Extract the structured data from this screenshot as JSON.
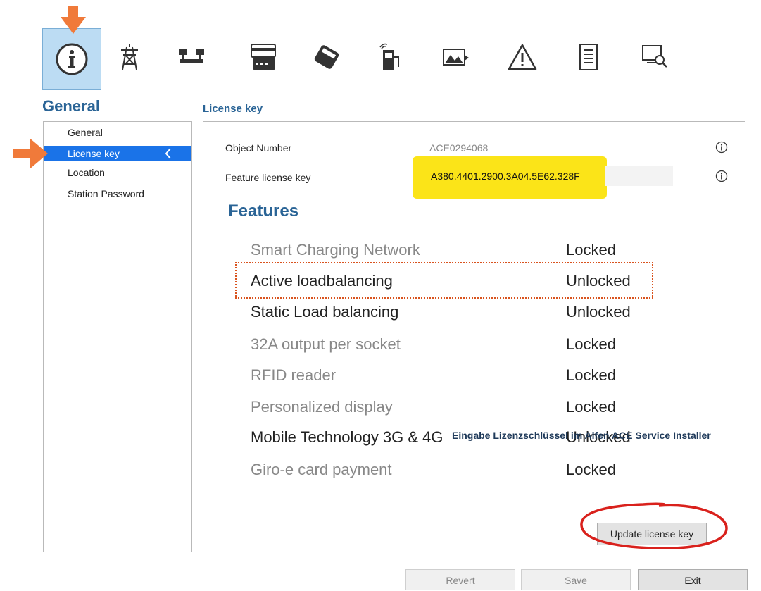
{
  "toolbar": {
    "icons": [
      "info-icon",
      "power-pylon-icon",
      "network-nodes-icon",
      "card-reader-icon",
      "payment-terminal-icon",
      "charging-station-icon",
      "display-image-icon",
      "warning-icon",
      "document-icon",
      "diagnostics-icon"
    ],
    "active_index": 0
  },
  "section": {
    "title": "General"
  },
  "nav": {
    "items": [
      {
        "label": "General"
      },
      {
        "label": "License key"
      },
      {
        "label": "Location"
      },
      {
        "label": "Station Password"
      }
    ],
    "selected_index": 1
  },
  "panel": {
    "title": "License key",
    "object_number_label": "Object Number",
    "object_number_value": "ACE0294068",
    "feature_key_label": "Feature license key",
    "feature_key_value": "A380.4401.2900.3A04.5E62.328F",
    "features_heading": "Features",
    "features": [
      {
        "name": "Smart Charging Network",
        "status": "Locked"
      },
      {
        "name": "Active loadbalancing",
        "status": "Unlocked"
      },
      {
        "name": "Static Load balancing",
        "status": "Unlocked"
      },
      {
        "name": "32A output per socket",
        "status": "Locked"
      },
      {
        "name": "RFID reader",
        "status": "Locked"
      },
      {
        "name": "Personalized display",
        "status": "Locked"
      },
      {
        "name": "Mobile Technology 3G & 4G",
        "status": "Unlocked"
      },
      {
        "name": "Giro-e card payment",
        "status": "Locked"
      }
    ],
    "update_button": "Update license key"
  },
  "overlay_note": "Eingabe Lizenzschlüssel im Alfen ACE Service Installer",
  "footer": {
    "revert": "Revert",
    "save": "Save",
    "exit": "Exit"
  },
  "colors": {
    "accent": "#1a73e8",
    "heading": "#2a6496",
    "highlight": "#fbe418",
    "annotation_orange": "#f07a3a",
    "annotation_red": "#d9211c"
  }
}
